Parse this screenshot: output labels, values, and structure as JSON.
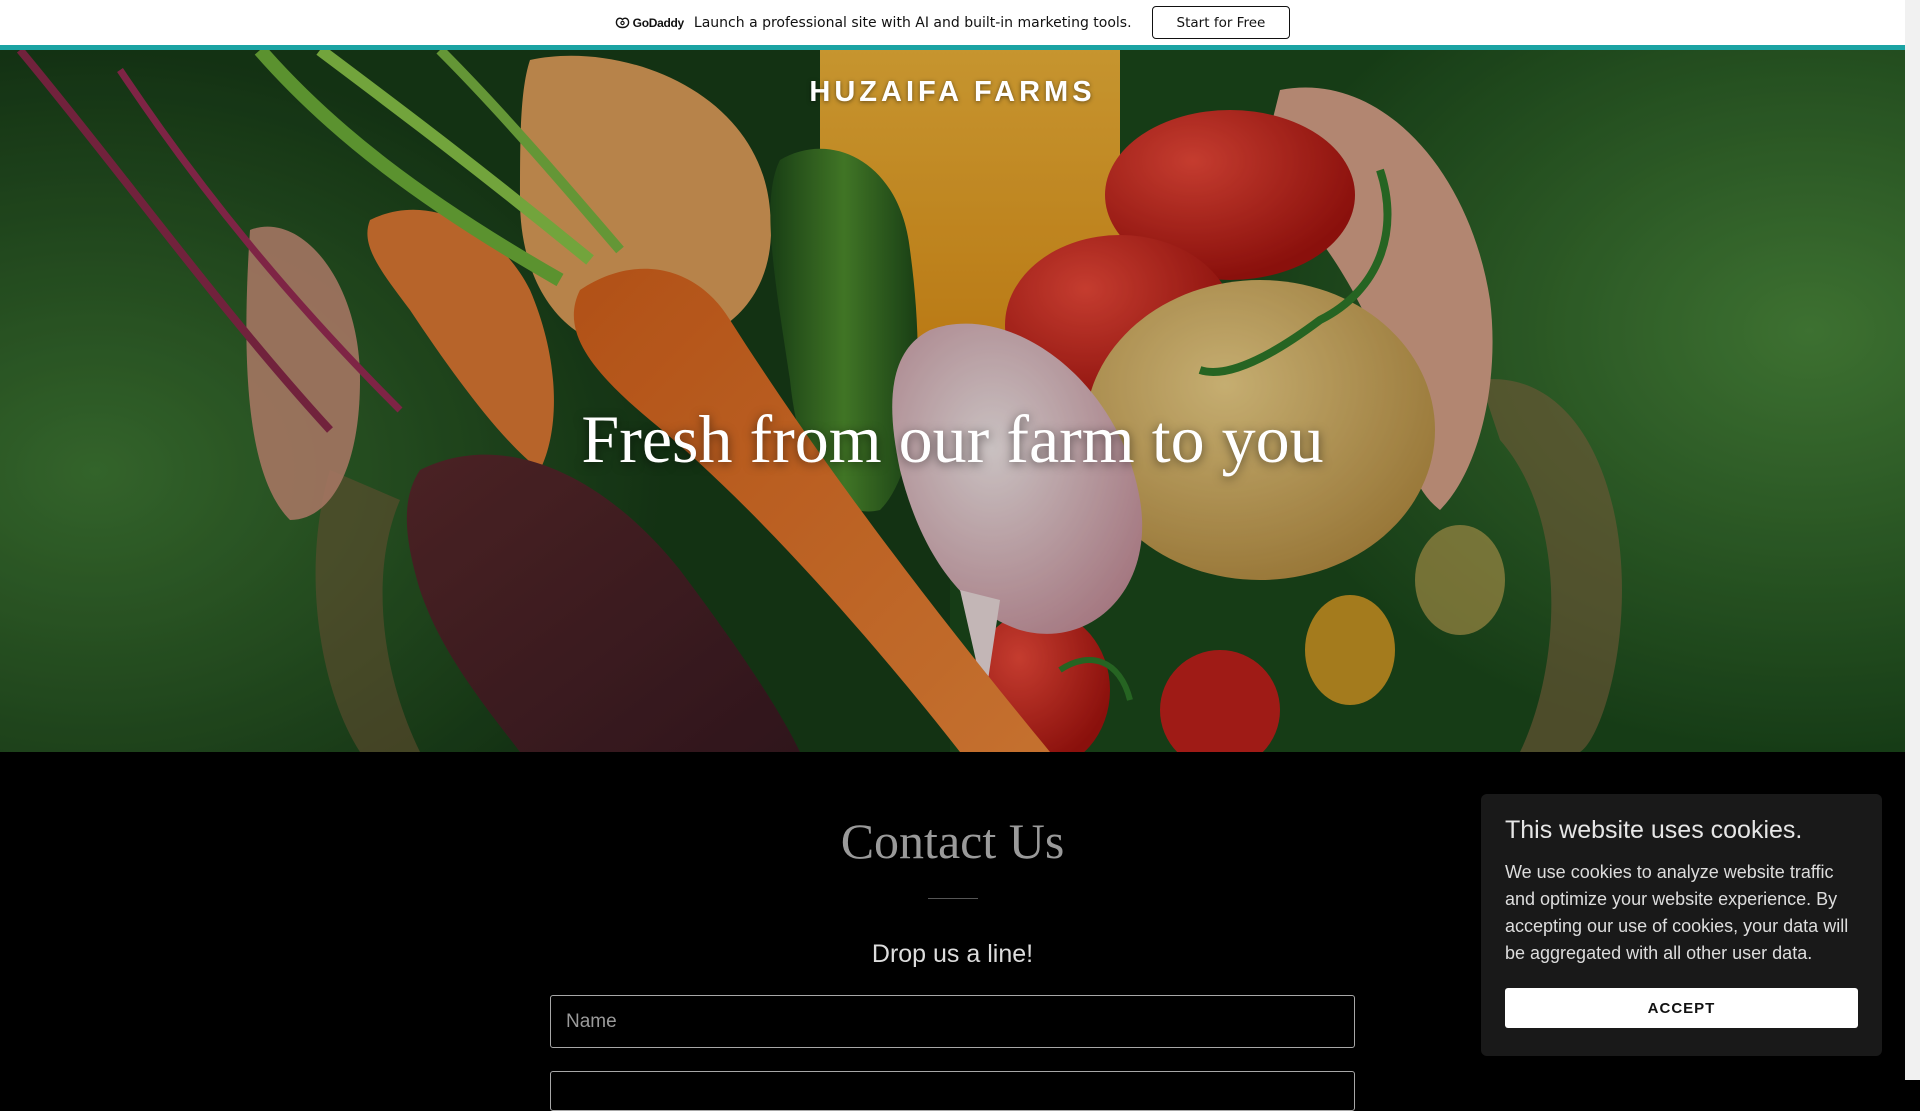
{
  "promo": {
    "logo_text": "GoDaddy",
    "message": "Launch a professional site with AI and built-in marketing tools.",
    "cta_label": "Start for Free",
    "accent_color": "#1ba3a3"
  },
  "hero": {
    "site_title": "HUZAIFA FARMS",
    "tagline": "Fresh from our farm to you"
  },
  "contact": {
    "title": "Contact Us",
    "subtitle": "Drop us a line!",
    "name_placeholder": "Name"
  },
  "cookie_notice": {
    "title": "This website uses cookies.",
    "body": "We use cookies to analyze website traffic and optimize your website experience. By accepting our use of cookies, your data will be aggregated with all other user data.",
    "accept_label": "ACCEPT"
  }
}
